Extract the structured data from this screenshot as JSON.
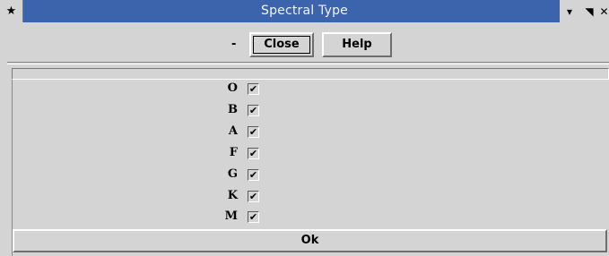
{
  "window": {
    "title": "Spectral Type",
    "pin_icon": "★",
    "menu_icon": "▾",
    "shade_icon": "◥",
    "close_icon": "✕"
  },
  "toolbar": {
    "dash": "-",
    "close_label": "Close",
    "help_label": "Help"
  },
  "types": [
    {
      "label": "O",
      "checked": true,
      "mark": "✔"
    },
    {
      "label": "B",
      "checked": true,
      "mark": "✔"
    },
    {
      "label": "A",
      "checked": true,
      "mark": "✔"
    },
    {
      "label": "F",
      "checked": true,
      "mark": "✔"
    },
    {
      "label": "G",
      "checked": true,
      "mark": "✔"
    },
    {
      "label": "K",
      "checked": true,
      "mark": "✔"
    },
    {
      "label": "M",
      "checked": true,
      "mark": "✔"
    }
  ],
  "footer": {
    "ok_label": "Ok"
  }
}
